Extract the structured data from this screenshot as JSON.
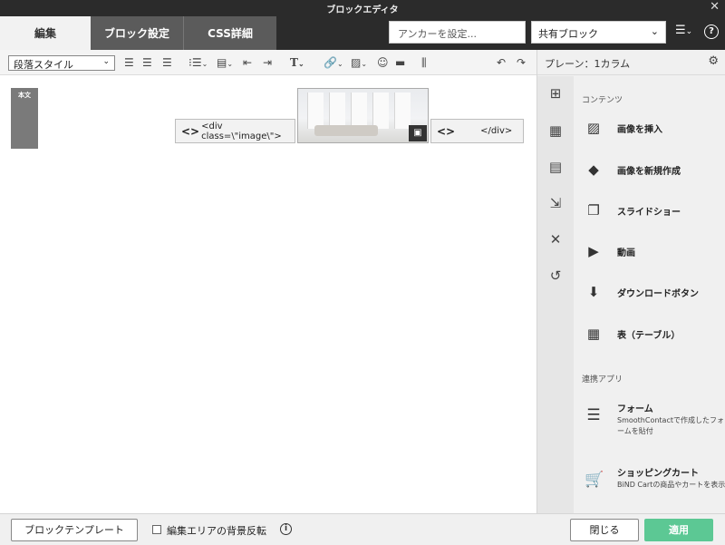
{
  "window": {
    "title": "ブロックエディタ",
    "close_icon": "close-icon"
  },
  "tabs": [
    {
      "label": "編集",
      "active": true
    },
    {
      "label": "ブロック設定",
      "active": false
    },
    {
      "label": "CSS詳細",
      "active": false
    }
  ],
  "header": {
    "anchor_placeholder": "アンカーを設定...",
    "shared_block": {
      "selected": "共有ブロック"
    },
    "menu_icon": "menu-icon",
    "help_icon": "help-icon"
  },
  "toolbar": {
    "paragraph_style": "段落スタイル",
    "icons": [
      "align-left-icon",
      "align-center-icon",
      "align-right-icon",
      "bullet-list-icon",
      "numbered-list-icon",
      "outdent-icon",
      "indent-icon",
      "text-type-icon",
      "link-icon",
      "image-icon",
      "emoji-icon",
      "horizontal-rule-icon",
      "column-icon",
      "undo-icon",
      "redo-icon"
    ]
  },
  "canvas": {
    "body_marker": "本文",
    "open_tag": "<div class=\\\"image\\\">",
    "close_tag": "</div>"
  },
  "panel": {
    "header_label": "プレーン：1カラム",
    "side_icons": [
      "add-block-icon",
      "grid-icon",
      "page-icon",
      "import-icon",
      "tools-icon",
      "history-icon"
    ],
    "section_contents": "コンテンツ",
    "items": [
      {
        "icon": "image-icon",
        "label": "画像を挿入"
      },
      {
        "icon": "shapes-icon",
        "label": "画像を新規作成"
      },
      {
        "icon": "slideshow-icon",
        "label": "スライドショー"
      },
      {
        "icon": "video-icon",
        "label": "動画"
      },
      {
        "icon": "download-icon",
        "label": "ダウンロードボタン"
      },
      {
        "icon": "table-icon",
        "label": "表（テーブル）"
      }
    ],
    "section_apps": "連携アプリ",
    "apps": [
      {
        "icon": "form-icon",
        "label": "フォーム",
        "desc": "SmoothContactで作成したフォームを貼付"
      },
      {
        "icon": "cart-icon",
        "label": "ショッピングカート",
        "desc": "BiND Cartの商品やカートを表示"
      }
    ]
  },
  "footer": {
    "template_button": "ブロックテンプレート",
    "invert_bg_label": "編集エリアの背景反転",
    "close_button": "閉じる",
    "apply_button": "適用"
  },
  "colors": {
    "apply": "#5cc894",
    "dark_bar": "#2b2b2b",
    "tab_inactive": "#5b5b5b"
  }
}
